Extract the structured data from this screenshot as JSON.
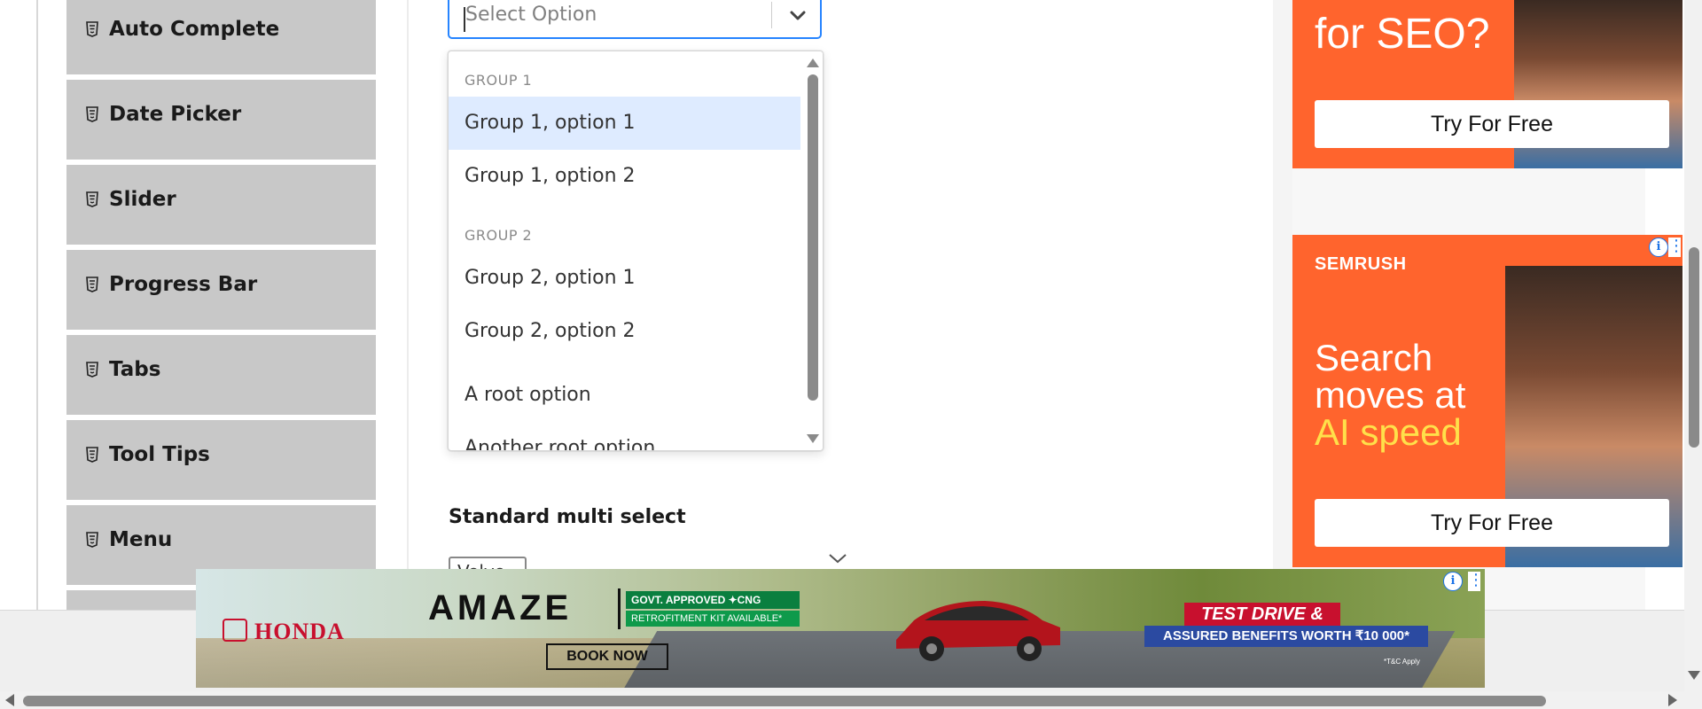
{
  "sidebar": {
    "items": [
      {
        "label": "Auto Complete"
      },
      {
        "label": "Date Picker"
      },
      {
        "label": "Slider"
      },
      {
        "label": "Progress Bar"
      },
      {
        "label": "Tabs"
      },
      {
        "label": "Tool Tips"
      },
      {
        "label": "Menu"
      }
    ]
  },
  "select": {
    "placeholder": "Select Option",
    "groups": [
      {
        "label": "GROUP 1",
        "options": [
          "Group 1, option 1",
          "Group 1, option 2"
        ]
      },
      {
        "label": "GROUP 2",
        "options": [
          "Group 2, option 1",
          "Group 2, option 2"
        ]
      }
    ],
    "root_options": [
      "A root option",
      "Another root option"
    ],
    "focused_option": "Group 1, option 1"
  },
  "multi_select": {
    "label": "Standard multi select",
    "value": "Volvo"
  },
  "ads": {
    "top_headline": "for SEO?",
    "top_cta": "Try For Free",
    "semrush_brand": "SEMRUSH",
    "semrush_headline_1": "Search",
    "semrush_headline_2": "moves at",
    "semrush_headline_3": "AI speed",
    "semrush_cta": "Try For Free",
    "info_icon": "i",
    "menu_dots": "⋮"
  },
  "banner": {
    "brand": "HONDA",
    "model": "AMAZE",
    "govt": "GOVT. APPROVED ✦CNG",
    "retro": "RETROFITMENT KIT AVAILABLE*",
    "book": "BOOK NOW",
    "tdw": "TEST DRIVE & WIN",
    "abw": "ASSURED BENEFITS WORTH ₹10 000*",
    "tnc": "*T&C Apply"
  },
  "colors": {
    "accent": "#2684ff",
    "focused_bg": "#deebff",
    "ad_orange": "#ff642d",
    "sidebar_bg": "#c8c8c8"
  }
}
